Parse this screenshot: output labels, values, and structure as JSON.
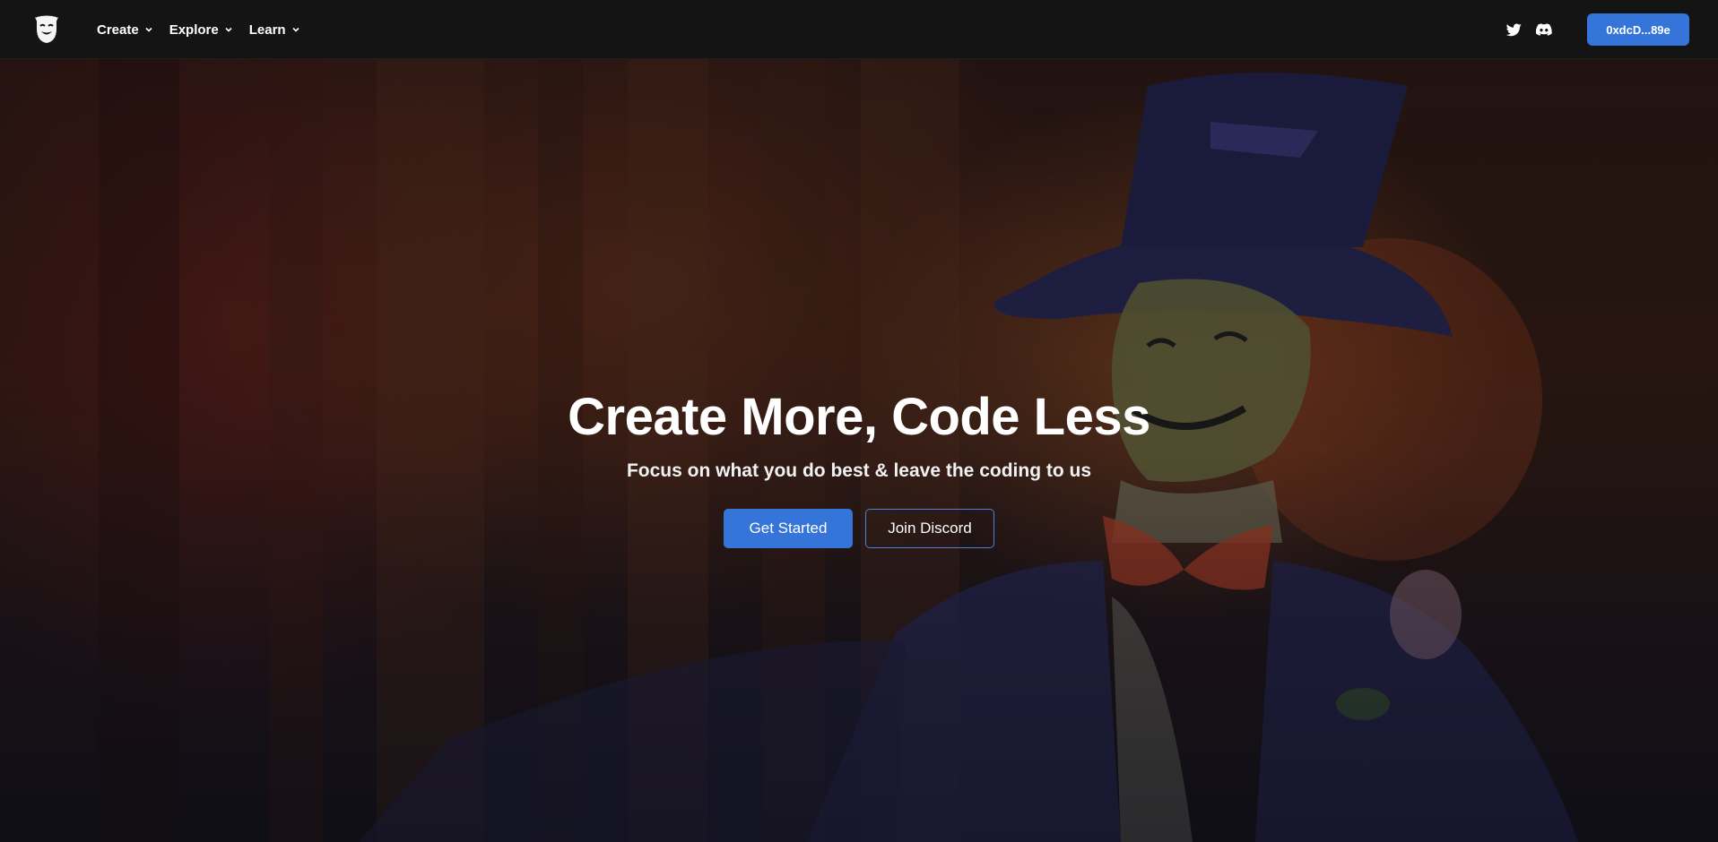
{
  "nav": {
    "logo": "theater-mask-logo",
    "items": [
      {
        "label": "Create",
        "icon": "chevron-down-icon"
      },
      {
        "label": "Explore",
        "icon": "chevron-down-icon"
      },
      {
        "label": "Learn",
        "icon": "chevron-down-icon"
      }
    ],
    "social": [
      {
        "name": "twitter-icon"
      },
      {
        "name": "discord-icon"
      }
    ],
    "wallet_label": "0xdcD...89e"
  },
  "hero": {
    "title": "Create More, Code Less",
    "subtitle": "Focus on what you do best & leave the coding to us",
    "primary_button": "Get Started",
    "secondary_button": "Join Discord"
  },
  "colors": {
    "accent": "#3574d8",
    "navbar_bg": "#141414"
  }
}
